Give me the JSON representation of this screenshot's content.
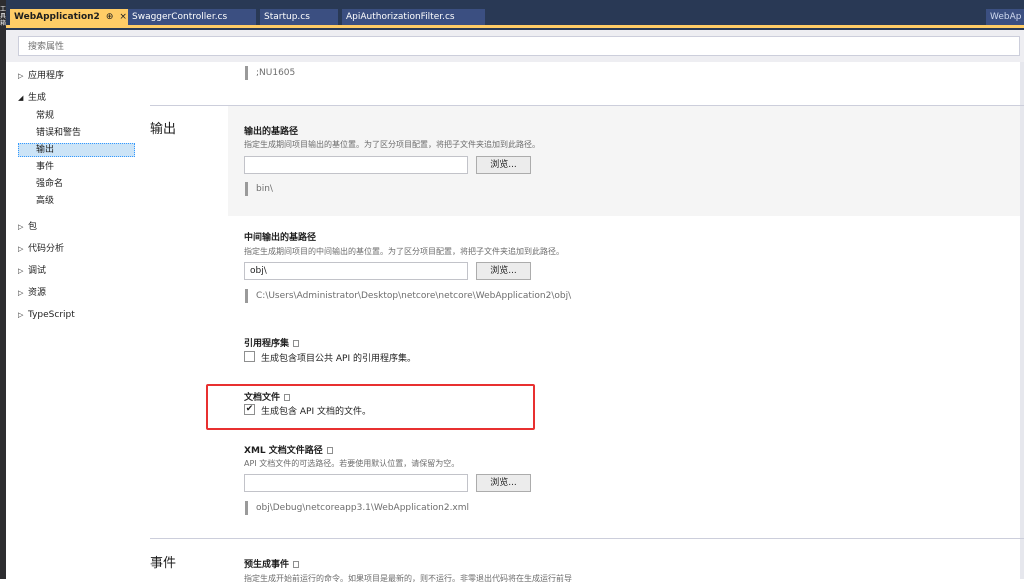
{
  "side_strip": {
    "text": "工具箱"
  },
  "tabs": [
    {
      "label": "WebApplication2",
      "pin": "⊕",
      "close": "×",
      "active": true
    },
    {
      "label": "SwaggerController.cs",
      "active": false
    },
    {
      "label": "Startup.cs",
      "active": false
    },
    {
      "label": "ApiAuthorizationFilter.cs",
      "active": false
    }
  ],
  "tab_right_label": "WebAp",
  "search": {
    "placeholder": "搜索属性"
  },
  "nav": {
    "app": "应用程序",
    "build": "生成",
    "build_children": [
      "常规",
      "错误和警告",
      "输出",
      "事件",
      "强命名",
      "高级"
    ],
    "package": "包",
    "code_analysis": "代码分析",
    "debug": "调试",
    "resources": "资源",
    "typescript": "TypeScript",
    "selected": "输出"
  },
  "top_value": ";NU1605",
  "sections": {
    "output": "输出",
    "events": "事件"
  },
  "output_base": {
    "title": "输出的基路径",
    "desc": "指定生成期间项目输出的基位置。为了区分项目配置，将把子文件夹追加到此路径。",
    "value": "",
    "browse": "浏览...",
    "resolved": "bin\\"
  },
  "intermediate": {
    "title": "中间输出的基路径",
    "desc": "指定生成期间项目的中间输出的基位置。为了区分项目配置，将把子文件夹追加到此路径。",
    "value": "obj\\",
    "browse": "浏览...",
    "resolved": "C:\\Users\\Administrator\\Desktop\\netcore\\netcore\\WebApplication2\\obj\\"
  },
  "reference_assembly": {
    "title": "引用程序集",
    "checkbox_label": "生成包含项目公共 API 的引用程序集。",
    "checked": false
  },
  "documentation_file": {
    "title": "文档文件",
    "checkbox_label": "生成包含 API 文档的文件。",
    "checked": true,
    "check_mark": "✔"
  },
  "xml_doc_path": {
    "title": "XML 文档文件路径",
    "desc": "API 文档文件的可选路径。若要使用默认位置，请保留为空。",
    "value": "",
    "browse": "浏览...",
    "resolved": "obj\\Debug\\netcoreapp3.1\\WebApplication2.xml"
  },
  "pre_build": {
    "title": "预生成事件",
    "desc": "指定生成开始前运行的命令。如果项目是最新的，则不运行。非零退出代码将在生成运行前导"
  },
  "colors": {
    "highlight": "#e83030",
    "tab_active": "#ffcc66",
    "tabbar": "#293955"
  }
}
